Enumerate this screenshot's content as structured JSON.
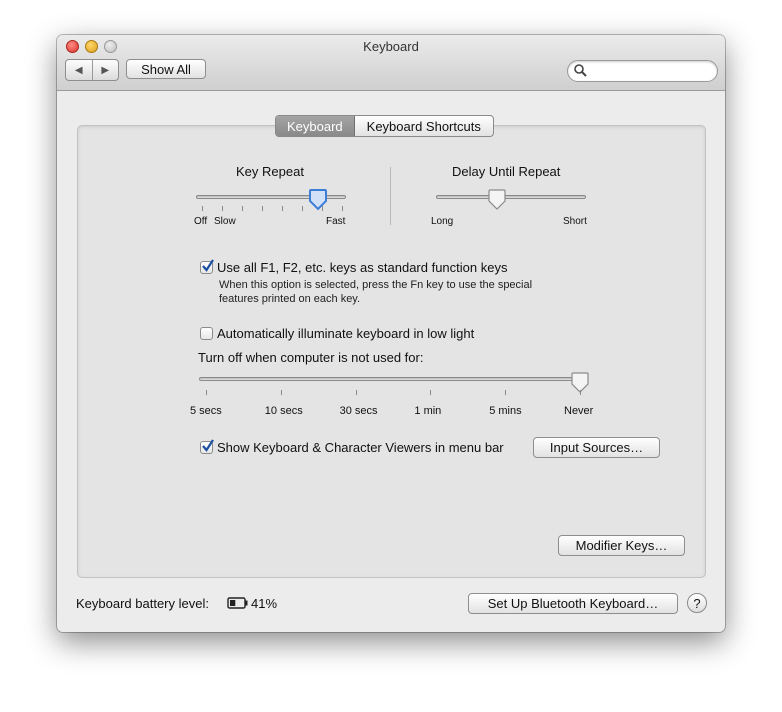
{
  "window": {
    "title": "Keyboard",
    "nav_back": "◀",
    "nav_forward": "▶",
    "show_all": "Show All",
    "search_placeholder": "",
    "search_value": ""
  },
  "tabs": [
    {
      "label": "Keyboard",
      "selected": true
    },
    {
      "label": "Keyboard Shortcuts",
      "selected": false
    }
  ],
  "key_repeat": {
    "label": "Key Repeat",
    "left_label": "Off",
    "slow_label": "Slow",
    "right_label": "Fast",
    "level_fraction": 0.8
  },
  "delay_until_repeat": {
    "label": "Delay Until Repeat",
    "left_label": "Long",
    "right_label": "Short",
    "level_fraction": 0.4
  },
  "fn_keys": {
    "label": "Use all F1, F2, etc. keys as standard function keys",
    "checked": true,
    "help": "When this option is selected, press the Fn key to use the special features printed on each key."
  },
  "illuminate": {
    "label": "Automatically illuminate keyboard in low light",
    "checked": false
  },
  "turn_off": {
    "label": "Turn off when computer is not used for:",
    "ticks": [
      "5 secs",
      "10 secs",
      "30 secs",
      "1 min",
      "5 mins",
      "Never"
    ],
    "selected": "Never"
  },
  "viewers": {
    "label": "Show Keyboard & Character Viewers in menu bar",
    "checked": true
  },
  "buttons": {
    "input_sources": "Input Sources…",
    "modifier_keys": "Modifier Keys…",
    "bluetooth": "Set Up Bluetooth Keyboard…",
    "help": "?"
  },
  "battery": {
    "label": "Keyboard battery level:",
    "value": "41%",
    "level_fraction": 0.41
  },
  "icons": [
    "search-icon",
    "checkmark-icon",
    "battery-icon",
    "help-icon"
  ]
}
